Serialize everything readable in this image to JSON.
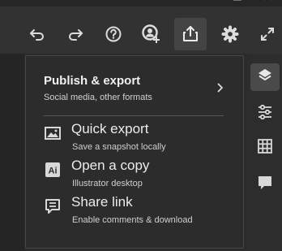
{
  "window": {
    "controls": [
      "minimize-icon",
      "maximize-icon",
      "close-icon"
    ]
  },
  "toolbar": {
    "icons": [
      "undo-icon",
      "redo-icon",
      "help-icon",
      "invite-icon",
      "share-export-icon",
      "settings-icon",
      "expand-icon"
    ],
    "active": "share-export-icon"
  },
  "panel": {
    "publish": {
      "title": "Publish & export",
      "subtitle": "Social media, other formats"
    },
    "items": [
      {
        "label": "Quick export",
        "description": "Save a snapshot locally",
        "icon": "image-icon"
      },
      {
        "label": "Open a copy",
        "description": "Illustrator desktop",
        "icon": "illustrator-icon",
        "badge": "Ai"
      },
      {
        "label": "Share link",
        "description": "Enable comments & download",
        "icon": "comment-icon"
      }
    ]
  },
  "rightbar": {
    "icons": [
      "layers-icon",
      "properties-icon",
      "grid-icon",
      "comments-icon"
    ],
    "active": "layers-icon"
  },
  "colors": {
    "toolbar": "#323232",
    "panel": "#2c2c2c",
    "text": "#ececec",
    "active": "#444444"
  }
}
